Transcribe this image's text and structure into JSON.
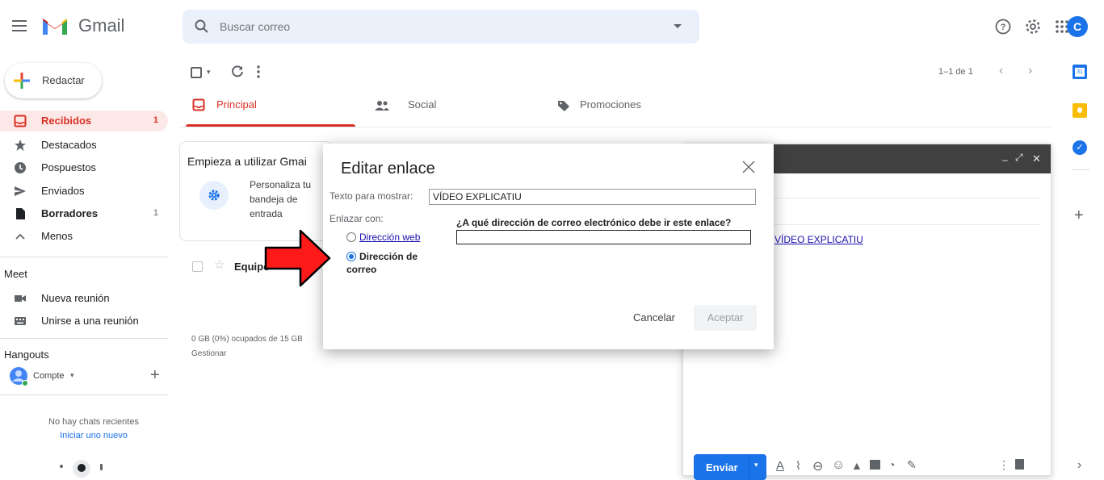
{
  "app": {
    "name": "Gmail"
  },
  "search": {
    "placeholder": "Buscar correo"
  },
  "account": {
    "initial": "C"
  },
  "sidebar": {
    "compose_label": "Redactar",
    "items": [
      {
        "label": "Recibidos",
        "count": "1"
      },
      {
        "label": "Destacados",
        "count": ""
      },
      {
        "label": "Pospuestos",
        "count": ""
      },
      {
        "label": "Enviados",
        "count": ""
      },
      {
        "label": "Borradores",
        "count": "1"
      },
      {
        "label": "Menos",
        "count": ""
      }
    ],
    "meet_title": "Meet",
    "meet_items": [
      "Nueva reunión",
      "Unirse a una reunión"
    ],
    "hangouts_title": "Hangouts",
    "hangouts_user": "Compte",
    "no_chats": "No hay chats recientes",
    "start_new": "Iniciar uno nuevo"
  },
  "toolbar": {
    "pagination": "1–1 de 1"
  },
  "tabs": [
    {
      "label": "Principal"
    },
    {
      "label": "Social"
    },
    {
      "label": "Promociones"
    }
  ],
  "starter": {
    "title": "Empieza a utilizar Gmai",
    "personalize": [
      "Personaliza tu",
      "bandeja de",
      "entrada"
    ]
  },
  "email_row": {
    "sender": "Equipo"
  },
  "storage": {
    "usage": "0 GB (0%) ocupados de 15 GB",
    "manage": "Gestionar"
  },
  "dialog": {
    "title": "Editar enlace",
    "display_text_label": "Texto para mostrar:",
    "display_text_value": "VÍDEO EXPLICATIU",
    "link_to_label": "Enlazar con:",
    "option_web": "Dirección web",
    "option_email_line1": "Dirección de",
    "option_email_line2": "correo",
    "question": "¿A qué dirección de correo electrónico debe ir este enlace?",
    "email_value": "",
    "cancel": "Cancelar",
    "accept": "Aceptar",
    "selected_option": "email"
  },
  "compose_window": {
    "link_text": "VÍDEO EXPLICATIU",
    "send_label": "Enviar"
  },
  "colors": {
    "accent_red": "#d93025",
    "link_blue": "#1a0dab",
    "button_blue": "#1a73e8",
    "arrow_red": "#ff1a1a"
  }
}
